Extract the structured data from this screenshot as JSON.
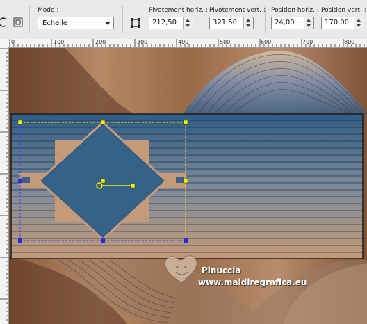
{
  "toolbar": {
    "mode_label": "Mode :",
    "mode_value": "Échelle",
    "pivot_h_label": "Pivotement horiz. :",
    "pivot_h_value": "212,50",
    "pivot_v_label": "Pivotement vert. :",
    "pivot_v_value": "321,50",
    "pos_h_label": "Position horiz. :",
    "pos_h_value": "24,00",
    "pos_v_label": "Position vert. :",
    "pos_v_value": "170,00"
  },
  "ruler": {
    "labels": [
      "0",
      "100",
      "200",
      "300",
      "400",
      "500",
      "600",
      "700",
      "800"
    ]
  },
  "watermark": {
    "line1": "Pinuccia",
    "line2": "www.maidiregrafica.eu"
  },
  "colors": {
    "blue": "#2f5c86",
    "tan": "#c49a78",
    "handle_yellow": "#f2f200",
    "handle_blue": "#2a2ae0"
  }
}
